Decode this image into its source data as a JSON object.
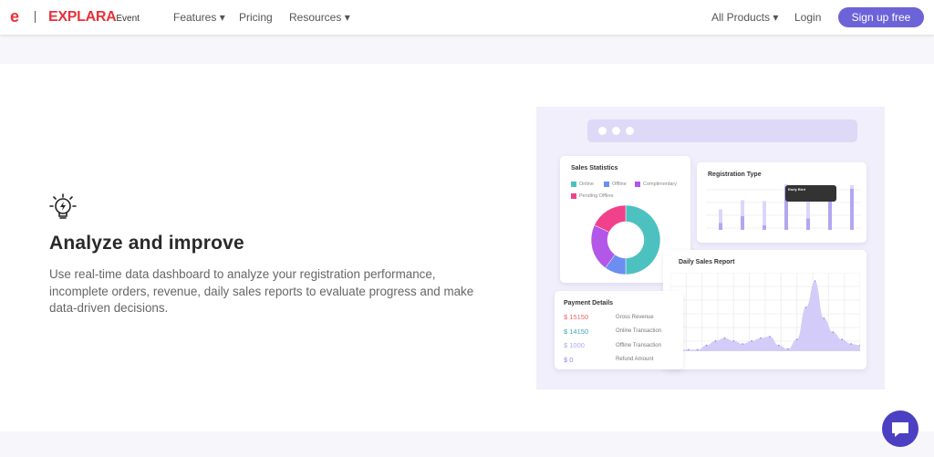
{
  "nav": {
    "brand": "EXPLARA",
    "brand_suffix": "Event",
    "features": "Features ▾",
    "pricing": "Pricing",
    "resources": "Resources ▾",
    "all_products": "All Products ▾",
    "login": "Login",
    "signup": "Sign up free"
  },
  "feature": {
    "icon": "lightbulb-bolt-icon",
    "title": "Analyze and improve",
    "description": "Use real-time data dashboard to analyze your registration performance, incomplete orders, revenue, daily sales reports to evaluate progress and make data-driven decisions."
  },
  "dashboard": {
    "sales_statistics": {
      "title": "Sales Statistics",
      "legend": [
        {
          "label": "Online",
          "color": "#4dc1c0",
          "value": 50
        },
        {
          "label": "Offline",
          "color": "#6b8ef0",
          "value": 10
        },
        {
          "label": "Complimentary",
          "color": "#b257e8",
          "value": 22
        },
        {
          "label": "Pending Offline",
          "color": "#f0418a",
          "value": 18
        }
      ]
    },
    "registration_type": {
      "title": "Registration Type",
      "tooltip_title": "Early Bird",
      "bars": [
        {
          "total": 45,
          "sold": 15
        },
        {
          "total": 65,
          "sold": 30
        },
        {
          "total": 63,
          "sold": 10
        },
        {
          "total": 100,
          "sold": 95
        },
        {
          "total": 72,
          "sold": 25
        },
        {
          "total": 85,
          "sold": 80
        },
        {
          "total": 98,
          "sold": 90
        }
      ]
    },
    "daily_sales": {
      "title": "Daily Sales Report",
      "values": [
        2,
        2,
        2,
        2,
        8,
        14,
        18,
        14,
        10,
        14,
        18,
        20,
        8,
        3,
        16,
        60,
        96,
        45,
        26,
        16,
        10,
        8
      ]
    },
    "payment_details": {
      "title": "Payment Details",
      "rows": [
        {
          "amount": "$ 15150",
          "label": "Gross Revenue",
          "color": "#e86a6a"
        },
        {
          "amount": "$ 14150",
          "label": "Online Transaction",
          "color": "#3aa7b5"
        },
        {
          "amount": "$ 1000",
          "label": "Offline Transaction",
          "color": "#a8a8f0"
        },
        {
          "amount": "$ 0",
          "label": "Refund Amount",
          "color": "#9b7df0"
        }
      ]
    }
  }
}
